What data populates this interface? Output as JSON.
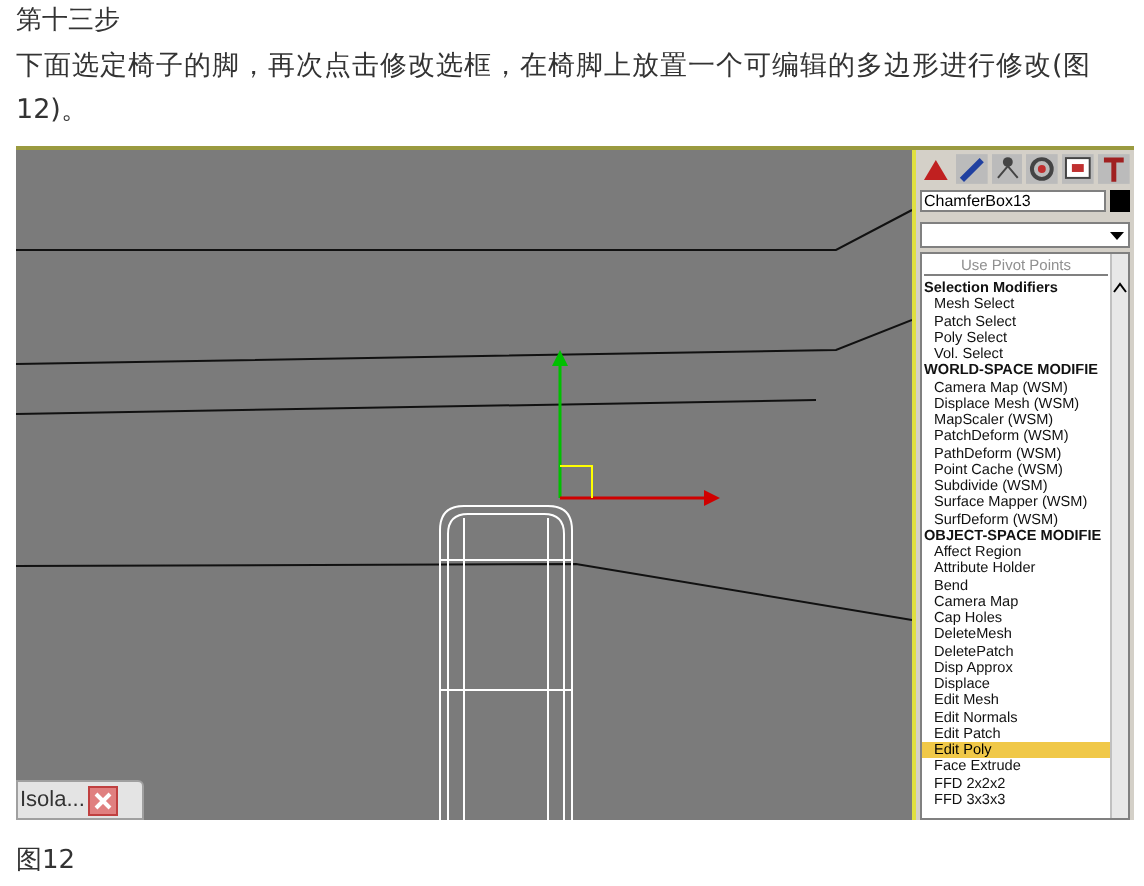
{
  "heading": "第十三步",
  "body": "下面选定椅子的脚，再次点击修改选框，在椅脚上放置一个可编辑的多边形进行修改(图12)。",
  "screenshot": {
    "isolate_tab": {
      "label": "Isola..."
    },
    "command_panel": {
      "object_name": "ChamferBox13",
      "pivot_button": {
        "label": "Use Pivot Points",
        "disabled": true
      },
      "modifier_list": [
        {
          "kind": "header",
          "label": "Selection Modifiers",
          "selected": false
        },
        {
          "kind": "item",
          "label": "Mesh Select",
          "selected": false
        },
        {
          "kind": "item",
          "label": "Patch Select",
          "selected": false
        },
        {
          "kind": "item",
          "label": "Poly Select",
          "selected": false
        },
        {
          "kind": "item",
          "label": "Vol. Select",
          "selected": false
        },
        {
          "kind": "header",
          "label": "WORLD-SPACE MODIFIE",
          "selected": false
        },
        {
          "kind": "item",
          "label": "Camera Map (WSM)",
          "selected": false
        },
        {
          "kind": "item",
          "label": "Displace Mesh (WSM)",
          "selected": false
        },
        {
          "kind": "item",
          "label": "MapScaler (WSM)",
          "selected": false
        },
        {
          "kind": "item",
          "label": "PatchDeform (WSM)",
          "selected": false
        },
        {
          "kind": "item",
          "label": "PathDeform (WSM)",
          "selected": false
        },
        {
          "kind": "item",
          "label": "Point Cache (WSM)",
          "selected": false
        },
        {
          "kind": "item",
          "label": "Subdivide (WSM)",
          "selected": false
        },
        {
          "kind": "item",
          "label": "Surface Mapper (WSM)",
          "selected": false
        },
        {
          "kind": "item",
          "label": "SurfDeform (WSM)",
          "selected": false
        },
        {
          "kind": "header",
          "label": "OBJECT-SPACE MODIFIE",
          "selected": false
        },
        {
          "kind": "item",
          "label": "Affect Region",
          "selected": false
        },
        {
          "kind": "item",
          "label": "Attribute Holder",
          "selected": false
        },
        {
          "kind": "item",
          "label": "Bend",
          "selected": false
        },
        {
          "kind": "item",
          "label": "Camera Map",
          "selected": false
        },
        {
          "kind": "item",
          "label": "Cap Holes",
          "selected": false
        },
        {
          "kind": "item",
          "label": "DeleteMesh",
          "selected": false
        },
        {
          "kind": "item",
          "label": "DeletePatch",
          "selected": false
        },
        {
          "kind": "item",
          "label": "Disp Approx",
          "selected": false
        },
        {
          "kind": "item",
          "label": "Displace",
          "selected": false
        },
        {
          "kind": "item",
          "label": "Edit Mesh",
          "selected": false
        },
        {
          "kind": "item",
          "label": "Edit Normals",
          "selected": false
        },
        {
          "kind": "item",
          "label": "Edit Patch",
          "selected": false
        },
        {
          "kind": "item",
          "label": "Edit Poly",
          "selected": true
        },
        {
          "kind": "item",
          "label": "Face Extrude",
          "selected": false
        },
        {
          "kind": "item",
          "label": "FFD 2x2x2",
          "selected": false
        },
        {
          "kind": "item",
          "label": "FFD 3x3x3",
          "selected": false
        }
      ]
    }
  },
  "caption": "图12"
}
